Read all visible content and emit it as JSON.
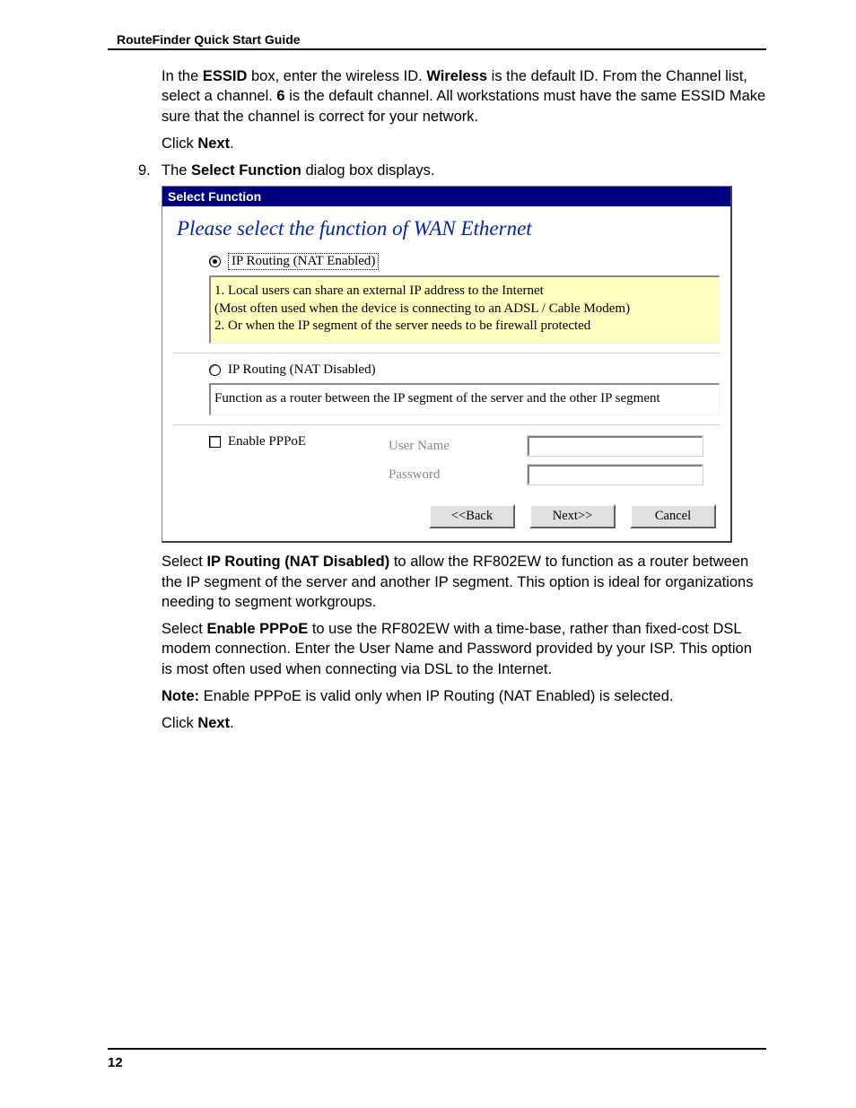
{
  "doc_title": "RouteFinder Quick Start Guide",
  "step_number": "9.",
  "intro": {
    "p1_a": "In the ",
    "p1_b1": "ESSID",
    "p1_c": " box, enter the wireless ID.  ",
    "p1_b2": "Wireless",
    "p1_d": " is the default ID.  From the Channel list, select a channel.  ",
    "p1_b3": "6",
    "p1_e": " is the default channel.  All workstations must have the same ESSID Make sure that the channel is correct for your network.",
    "click_a": "Click ",
    "click_b": "Next",
    "click_c": "."
  },
  "step_line_a": "The ",
  "step_line_b": "Select Function",
  "step_line_c": " dialog box displays.",
  "dlg": {
    "title": "Select Function",
    "headline": "Please select the function of WAN Ethernet",
    "opt1_label": "IP Routing (NAT Enabled)",
    "opt1_desc_l1": "1. Local users can share an external IP address to the Internet",
    "opt1_desc_l2": "(Most often used when the device is connecting to an ADSL / Cable Modem)",
    "opt1_desc_l3": "2. Or when the IP segment of the server needs to be firewall protected",
    "opt2_label": "IP Routing (NAT Disabled)",
    "opt2_desc": "Function as a router between the IP segment of the server and the other IP segment",
    "pppoe_label": "Enable PPPoE",
    "user_label": "User Name",
    "pass_label": "Password",
    "btn_back": "<<Back",
    "btn_next": "Next>>",
    "btn_cancel": "Cancel"
  },
  "after": {
    "p1_a": "Select ",
    "p1_b": "IP Routing (NAT Disabled)",
    "p1_c": " to allow the RF802EW to function as a router between the IP segment of the server and another IP segment.  This option is ideal for organizations needing to segment workgroups.",
    "p2_a": "Select ",
    "p2_b": "Enable PPPoE",
    "p2_c": " to use the RF802EW with a time-base, rather than fixed-cost DSL modem connection. Enter the User Name and Password provided by your ISP.  This option is most often used when connecting via DSL to the Internet.",
    "p3_a": "Note:",
    "p3_b": " Enable PPPoE is valid only when IP Routing (NAT Enabled) is selected.",
    "p4_a": "Click ",
    "p4_b": "Next",
    "p4_c": "."
  },
  "page_number": "12"
}
